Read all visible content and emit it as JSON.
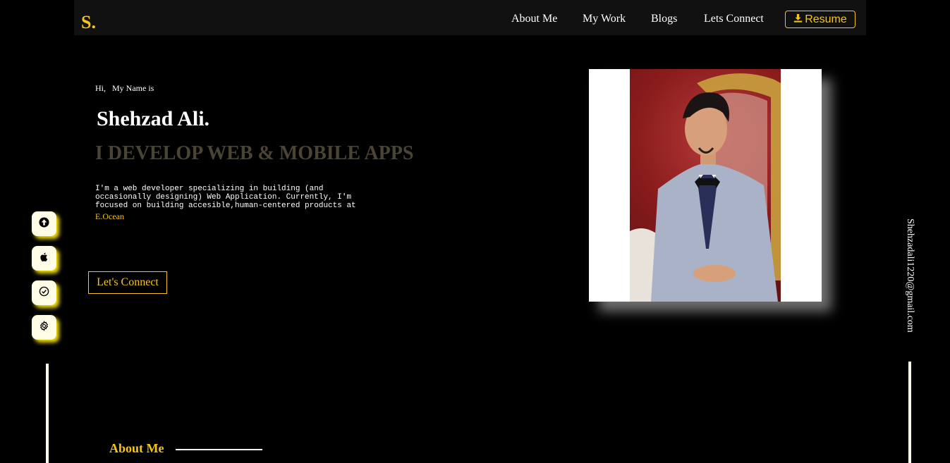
{
  "header": {
    "logo": "S.",
    "nav": {
      "about": "About Me",
      "work": "My Work",
      "blogs": "Blogs",
      "connect": "Lets Connect"
    },
    "resume_label": "Resume",
    "resume_icon": "download-icon"
  },
  "hero": {
    "greeting": "Hi,   My Name is",
    "name": "Shehzad Ali.",
    "tagline": "I DEVELOP WEB & MOBILE APPS",
    "description": "I'm a web developer specializing in building (and occasionally designing) Web Application. Currently, I'm focused on building accesible,human-centered products at",
    "company": "E.Ocean",
    "cta_label": "Let's Connect"
  },
  "social": {
    "icons": [
      "upload-icon",
      "apple-icon",
      "check-circle-icon",
      "gear-icon"
    ]
  },
  "email": "Shehzadali1220@gmail.com",
  "about": {
    "heading": "About Me"
  },
  "colors": {
    "accent": "#f5c518",
    "background": "#000000",
    "navbar": "#111111",
    "tagline": "#4a4434"
  }
}
